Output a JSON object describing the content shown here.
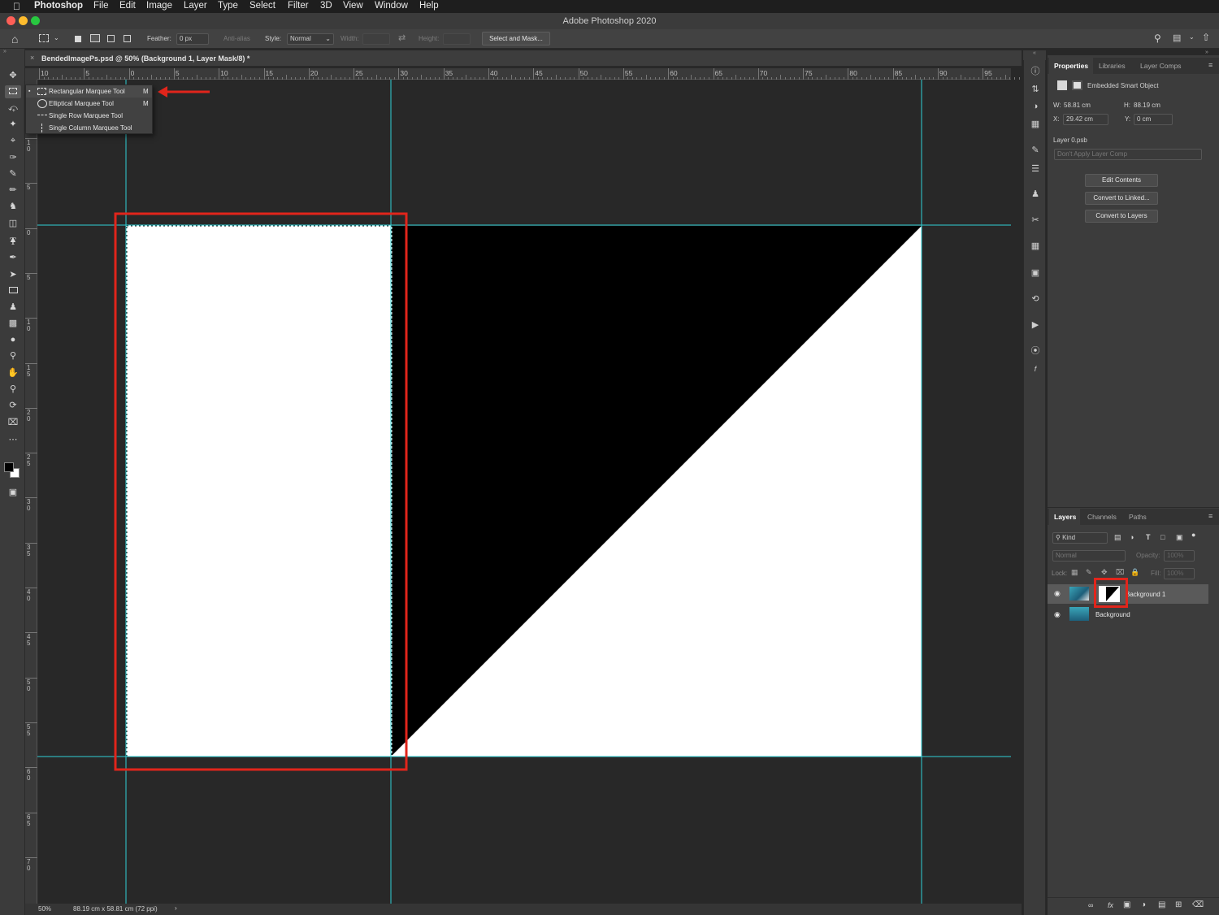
{
  "menubar": {
    "app": "Photoshop",
    "items": [
      "File",
      "Edit",
      "Image",
      "Layer",
      "Type",
      "Select",
      "Filter",
      "3D",
      "View",
      "Window",
      "Help"
    ]
  },
  "window": {
    "title": "Adobe Photoshop 2020"
  },
  "options": {
    "feather_label": "Feather:",
    "feather_value": "0 px",
    "antialias_label": "Anti-alias",
    "style_label": "Style:",
    "style_value": "Normal",
    "width_label": "Width:",
    "height_label": "Height:",
    "select_mask_label": "Select and Mask..."
  },
  "document": {
    "tab_title": "BendedImagePs.psd @ 50% (Background 1, Layer Mask/8) *",
    "zoom": "50%",
    "doc_info": "88.19 cm x 58.81 cm (72 ppi)",
    "ruler_top_labels": [
      "10",
      "5",
      "0",
      "5",
      "10",
      "15",
      "20",
      "25",
      "30",
      "35",
      "40",
      "45",
      "50",
      "55",
      "60",
      "65",
      "70",
      "75",
      "80",
      "85",
      "90",
      "95"
    ],
    "ruler_left_labels": [
      "1 0",
      "5",
      "0",
      "5",
      "1 0",
      "1 5",
      "2 0",
      "2 5",
      "3 0",
      "3 5",
      "4 0",
      "4 5",
      "5 0",
      "5 5",
      "6 0",
      "6 5",
      "7 0"
    ]
  },
  "tool_flyout": [
    {
      "label": "Rectangular Marquee Tool",
      "key": "M",
      "active": true
    },
    {
      "label": "Elliptical Marquee Tool",
      "key": "M",
      "active": false
    },
    {
      "label": "Single Row Marquee Tool",
      "key": "",
      "active": false
    },
    {
      "label": "Single Column Marquee Tool",
      "key": "",
      "active": false
    }
  ],
  "properties": {
    "tabs": [
      "Properties",
      "Libraries",
      "Layer Comps"
    ],
    "type_label": "Embedded Smart Object",
    "w_label": "W:",
    "w_value": "58.81 cm",
    "h_label": "H:",
    "h_value": "88.19 cm",
    "x_label": "X:",
    "x_value": "29.42 cm",
    "y_label": "Y:",
    "y_value": "0 cm",
    "file_name": "Layer 0.psb",
    "layer_comp": "Don't Apply Layer Comp",
    "buttons": [
      "Edit Contents",
      "Convert to Linked...",
      "Convert to Layers"
    ]
  },
  "layers": {
    "tabs": [
      "Layers",
      "Channels",
      "Paths"
    ],
    "filter_kind": "Kind",
    "blend_mode": "Normal",
    "opacity_label": "Opacity:",
    "opacity_value": "100%",
    "lock_label": "Lock:",
    "fill_label": "Fill:",
    "fill_value": "100%",
    "items": [
      {
        "name": "Background 1",
        "selected": true
      },
      {
        "name": "Background",
        "selected": false
      }
    ]
  },
  "colors": {
    "guide": "#2fd0d6",
    "highlight": "#e1251b",
    "canvas_bg": "#282828"
  }
}
